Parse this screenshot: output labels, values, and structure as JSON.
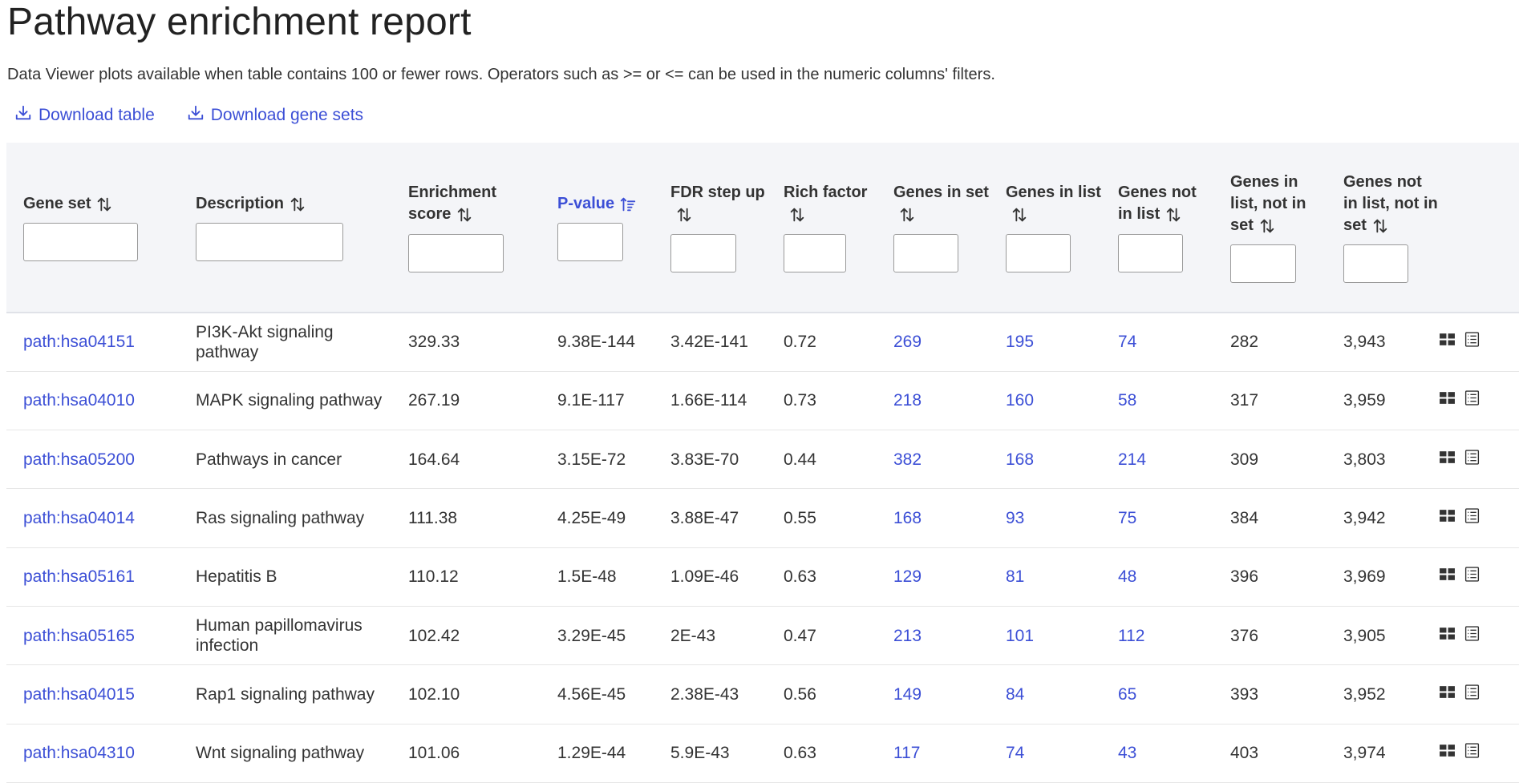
{
  "page": {
    "title": "Pathway enrichment report",
    "subtitle": "Data Viewer plots available when table contains 100 or fewer rows. Operators such as >= or <= can be used in the numeric columns' filters."
  },
  "downloads": {
    "table_label": "Download table",
    "gene_sets_label": "Download gene sets",
    "icon": "download-icon"
  },
  "colors": {
    "accent": "#3c4fd6",
    "header_bg": "#f4f5f8"
  },
  "table": {
    "columns": [
      {
        "label": "Gene set",
        "sort": "unsorted"
      },
      {
        "label": "Description",
        "sort": "unsorted"
      },
      {
        "label": "Enrichment score",
        "sort": "unsorted"
      },
      {
        "label": "P-value",
        "sort": "ascending"
      },
      {
        "label": "FDR step up",
        "sort": "unsorted"
      },
      {
        "label": "Rich factor",
        "sort": "unsorted"
      },
      {
        "label": "Genes in set",
        "sort": "unsorted"
      },
      {
        "label": "Genes in list",
        "sort": "unsorted"
      },
      {
        "label": "Genes not in list",
        "sort": "unsorted"
      },
      {
        "label": "Genes in list, not in set",
        "sort": "unsorted"
      },
      {
        "label": "Genes not in list, not in set",
        "sort": "unsorted"
      }
    ],
    "rows": [
      {
        "gene_set": "path:hsa04151",
        "description": "PI3K-Akt signaling pathway",
        "enrichment": "329.33",
        "pvalue": "9.38E-144",
        "fdr": "3.42E-141",
        "rich": "0.72",
        "in_set": "269",
        "in_list": "195",
        "not_in_list": "74",
        "in_list_not_set": "282",
        "not_list_not_set": "3,943"
      },
      {
        "gene_set": "path:hsa04010",
        "description": "MAPK signaling pathway",
        "enrichment": "267.19",
        "pvalue": "9.1E-117",
        "fdr": "1.66E-114",
        "rich": "0.73",
        "in_set": "218",
        "in_list": "160",
        "not_in_list": "58",
        "in_list_not_set": "317",
        "not_list_not_set": "3,959"
      },
      {
        "gene_set": "path:hsa05200",
        "description": "Pathways in cancer",
        "enrichment": "164.64",
        "pvalue": "3.15E-72",
        "fdr": "3.83E-70",
        "rich": "0.44",
        "in_set": "382",
        "in_list": "168",
        "not_in_list": "214",
        "in_list_not_set": "309",
        "not_list_not_set": "3,803"
      },
      {
        "gene_set": "path:hsa04014",
        "description": "Ras signaling pathway",
        "enrichment": "111.38",
        "pvalue": "4.25E-49",
        "fdr": "3.88E-47",
        "rich": "0.55",
        "in_set": "168",
        "in_list": "93",
        "not_in_list": "75",
        "in_list_not_set": "384",
        "not_list_not_set": "3,942"
      },
      {
        "gene_set": "path:hsa05161",
        "description": "Hepatitis B",
        "enrichment": "110.12",
        "pvalue": "1.5E-48",
        "fdr": "1.09E-46",
        "rich": "0.63",
        "in_set": "129",
        "in_list": "81",
        "not_in_list": "48",
        "in_list_not_set": "396",
        "not_list_not_set": "3,969"
      },
      {
        "gene_set": "path:hsa05165",
        "description": "Human papillomavirus infection",
        "enrichment": "102.42",
        "pvalue": "3.29E-45",
        "fdr": "2E-43",
        "rich": "0.47",
        "in_set": "213",
        "in_list": "101",
        "not_in_list": "112",
        "in_list_not_set": "376",
        "not_list_not_set": "3,905"
      },
      {
        "gene_set": "path:hsa04015",
        "description": "Rap1 signaling pathway",
        "enrichment": "102.10",
        "pvalue": "4.56E-45",
        "fdr": "2.38E-43",
        "rich": "0.56",
        "in_set": "149",
        "in_list": "84",
        "not_in_list": "65",
        "in_list_not_set": "393",
        "not_list_not_set": "3,952"
      },
      {
        "gene_set": "path:hsa04310",
        "description": "Wnt signaling pathway",
        "enrichment": "101.06",
        "pvalue": "1.29E-44",
        "fdr": "5.9E-43",
        "rich": "0.63",
        "in_set": "117",
        "in_list": "74",
        "not_in_list": "43",
        "in_list_not_set": "403",
        "not_list_not_set": "3,974"
      }
    ],
    "row_action_icons": [
      "grid-view-icon",
      "list-details-icon"
    ]
  }
}
